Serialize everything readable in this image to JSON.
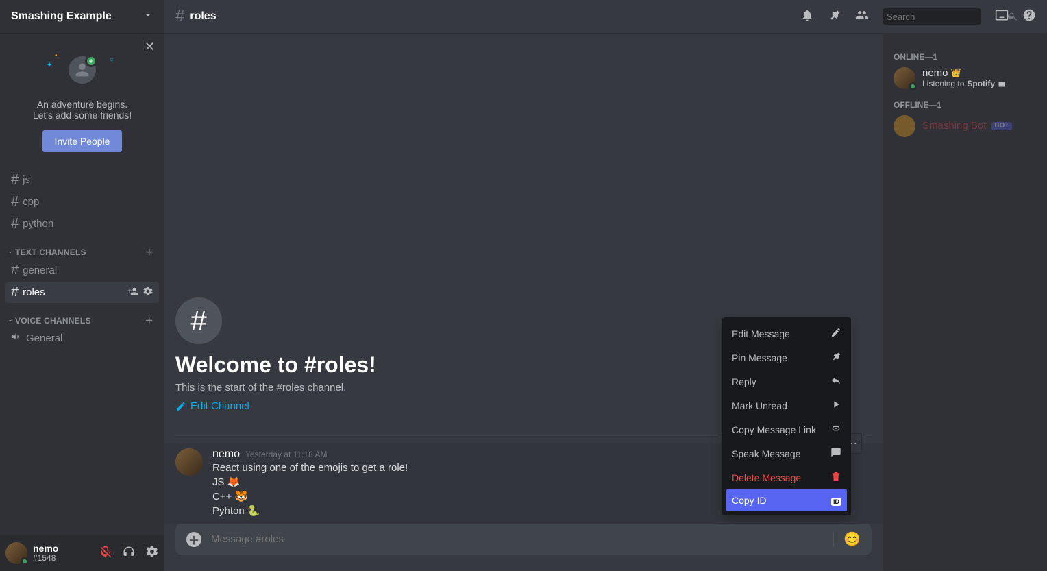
{
  "server": {
    "name": "Smashing Example"
  },
  "invite": {
    "line1": "An adventure begins.",
    "line2": "Let's add some friends!",
    "button": "Invite People"
  },
  "channels": {
    "top": [
      "js",
      "cpp",
      "python"
    ],
    "text_header": "Text Channels",
    "text": [
      {
        "name": "general",
        "active": false
      },
      {
        "name": "roles",
        "active": true
      }
    ],
    "voice_header": "Voice Channels",
    "voice": [
      {
        "name": "General"
      }
    ]
  },
  "user": {
    "name": "nemo",
    "tag": "#1548"
  },
  "header": {
    "channel": "roles",
    "search_placeholder": "Search"
  },
  "welcome": {
    "title": "Welcome to #roles!",
    "subtitle": "This is the start of the #roles channel.",
    "edit": "Edit Channel"
  },
  "message": {
    "author": "nemo",
    "timestamp": "Yesterday at 11:18 AM",
    "lines": [
      "React using one of the emojis to get a role!",
      "JS 🦊",
      "C++ 🐯",
      "Pyhton 🐍"
    ]
  },
  "context_menu": [
    {
      "label": "Edit Message",
      "icon": "pencil"
    },
    {
      "label": "Pin Message",
      "icon": "pin"
    },
    {
      "label": "Reply",
      "icon": "reply"
    },
    {
      "label": "Mark Unread",
      "icon": "mark"
    },
    {
      "label": "Copy Message Link",
      "icon": "link"
    },
    {
      "label": "Speak Message",
      "icon": "speak"
    },
    {
      "label": "Delete Message",
      "icon": "trash",
      "danger": true
    },
    {
      "label": "Copy ID",
      "icon": "id",
      "active": true
    }
  ],
  "compose": {
    "placeholder": "Message #roles"
  },
  "members": {
    "online_label": "Online—1",
    "online": [
      {
        "name": "nemo",
        "owner": true,
        "activity_prefix": "Listening to ",
        "activity_app": "Spotify"
      }
    ],
    "offline_label": "Offline—1",
    "offline": [
      {
        "name": "Smashing Bot",
        "bot": true
      }
    ]
  }
}
